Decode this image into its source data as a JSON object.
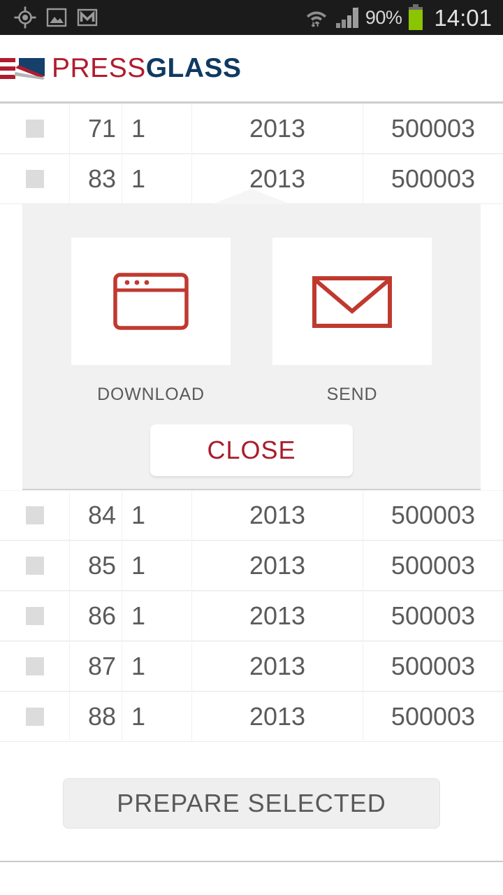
{
  "status_bar": {
    "left_icons": [
      {
        "name": "gps-location-icon",
        "glyph": "location"
      },
      {
        "name": "gallery-image-icon",
        "glyph": "image"
      },
      {
        "name": "gmail-icon",
        "glyph": "gmail"
      }
    ],
    "wifi_icon": "wifi-data-transfer-icon",
    "signal_icon": "cellular-signal-icon",
    "battery_percent": "90%",
    "battery_icon": "battery-icon",
    "battery_color": "#8bc400",
    "clock": "14:01",
    "background_color": "#1b1b1b"
  },
  "header": {
    "logo_mark_name": "pressglass-logo-mark",
    "brand_part_1": "PRESS",
    "brand_part_2": "GLASS",
    "brand_color_1": "#b01c2e",
    "brand_color_2": "#0e3a62"
  },
  "table": {
    "rows_above": [
      {
        "checked": false,
        "number": "71",
        "qty": "1",
        "year": "2013",
        "code": "500003"
      },
      {
        "checked": false,
        "number": "83",
        "qty": "1",
        "year": "2013",
        "code": "500003"
      }
    ],
    "rows_below": [
      {
        "checked": false,
        "number": "84",
        "qty": "1",
        "year": "2013",
        "code": "500003"
      },
      {
        "checked": false,
        "number": "85",
        "qty": "1",
        "year": "2013",
        "code": "500003"
      },
      {
        "checked": false,
        "number": "86",
        "qty": "1",
        "year": "2013",
        "code": "500003"
      },
      {
        "checked": false,
        "number": "87",
        "qty": "1",
        "year": "2013",
        "code": "500003"
      },
      {
        "checked": false,
        "number": "88",
        "qty": "1",
        "year": "2013",
        "code": "500003"
      }
    ]
  },
  "popup": {
    "actions": [
      {
        "icon_name": "browser-window-icon",
        "label": "DOWNLOAD"
      },
      {
        "icon_name": "envelope-icon",
        "label": "SEND"
      }
    ],
    "close_label": "CLOSE",
    "close_color": "#a81c2a",
    "background_color": "#f1f1f1",
    "icon_color": "#c0392f"
  },
  "footer": {
    "prepare_label": "PREPARE SELECTED"
  }
}
